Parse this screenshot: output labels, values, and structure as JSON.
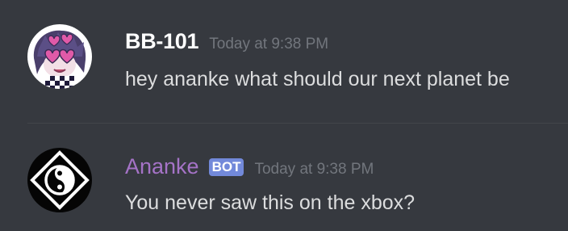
{
  "messages": [
    {
      "author": "BB-101",
      "author_color": "#ffffff",
      "timestamp": "Today at 9:38 PM",
      "text": "hey ananke what should our next planet be",
      "avatar_icon": "anime-character-avatar"
    },
    {
      "author": "Ananke",
      "author_color": "#a573c7",
      "bot_tag": "BOT",
      "timestamp": "Today at 9:38 PM",
      "text": "You never saw this on the xbox?",
      "avatar_icon": "ananke-logo-avatar"
    }
  ],
  "colors": {
    "background": "#36393f",
    "bot_tag": "#7289da",
    "timestamp": "#72767d",
    "message_text": "#dcddde"
  }
}
